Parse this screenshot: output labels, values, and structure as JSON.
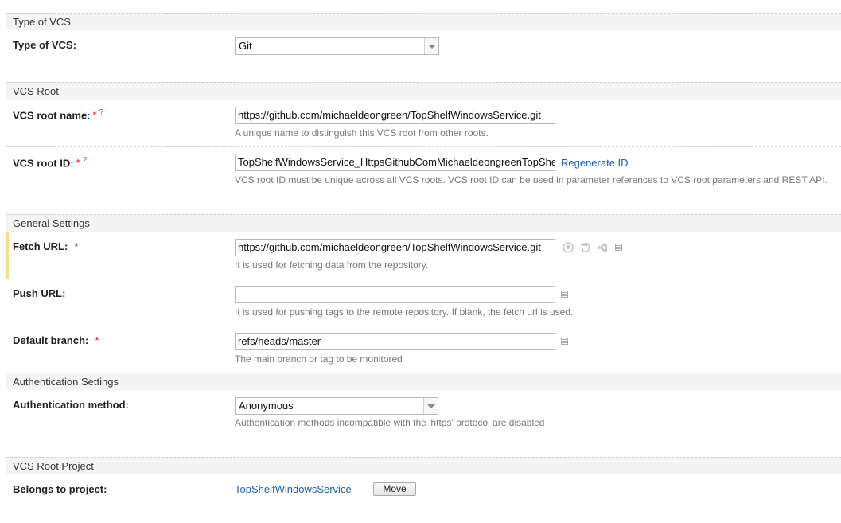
{
  "sections": {
    "type_of_vcs": "Type of VCS",
    "vcs_root": "VCS Root",
    "general_settings": "General Settings",
    "authentication_settings": "Authentication Settings",
    "vcs_root_project": "VCS Root Project"
  },
  "type_of_vcs": {
    "label": "Type of VCS:",
    "value": "Git"
  },
  "vcs_root_name": {
    "label": "VCS root name:",
    "required": "*",
    "help": "?",
    "value": "https://github.com/michaeldeongreen/TopShelfWindowsService.git",
    "note": "A unique name to distinguish this VCS root from other roots."
  },
  "vcs_root_id": {
    "label": "VCS root ID:",
    "required": "*",
    "help": "?",
    "value": "TopShelfWindowsService_HttpsGithubComMichaeldeongreenTopShe",
    "regenerate": "Regenerate ID",
    "note": "VCS root ID must be unique across all VCS roots. VCS root ID can be used in parameter references to VCS root parameters and REST API."
  },
  "fetch_url": {
    "label": "Fetch URL:",
    "required": "*",
    "value": "https://github.com/michaeldeongreen/TopShelfWindowsService.git",
    "note": "It is used for fetching data from the repository."
  },
  "push_url": {
    "label": "Push URL:",
    "value": "",
    "note": "It is used for pushing tags to the remote repository. If blank, the fetch url is used."
  },
  "default_branch": {
    "label": "Default branch:",
    "required": "*",
    "value": "refs/heads/master",
    "note": "The main branch or tag to be monitored"
  },
  "auth_method": {
    "label": "Authentication method:",
    "value": "Anonymous",
    "note": "Authentication methods incompatible with the 'https' protocol are disabled"
  },
  "belongs_to": {
    "label": "Belongs to project:",
    "project": "TopShelfWindowsService",
    "move": "Move"
  }
}
